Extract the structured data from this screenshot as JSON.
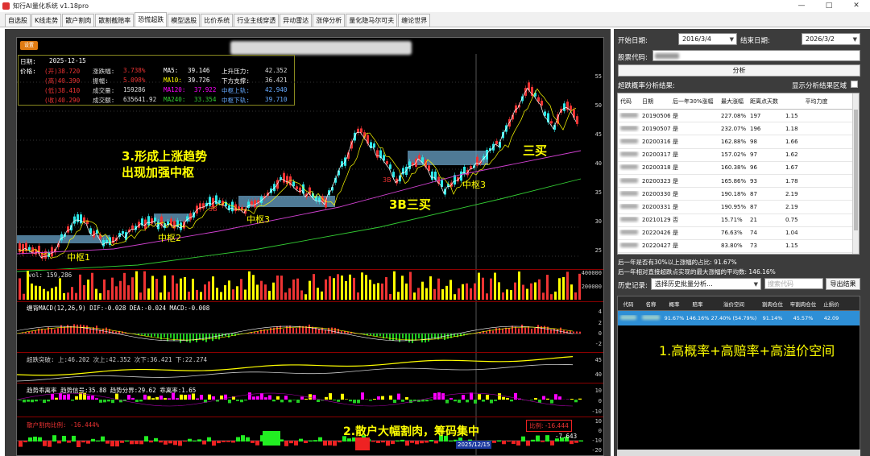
{
  "window": {
    "title": "知行AI量化系统 v1.18pro",
    "min": "—",
    "max": "□",
    "close": "✕"
  },
  "tabs": [
    "自选股",
    "K线走势",
    "散户割肉",
    "散割截赔率",
    "恐慌超跌",
    "模型选股",
    "比价系统",
    "行业主线穿透",
    "异动雷达",
    "涨停分析",
    "量化隐马尔可夫",
    "缠论世界"
  ],
  "active_tab": 4,
  "chart": {
    "set_button": "设置",
    "info": {
      "date_label": "日期:",
      "date": "2025-12-15",
      "price_label": "价格:",
      "open": "(开)38.720",
      "high": "(高)40.390",
      "low": "(低)38.410",
      "close": "(收)40.290",
      "chg_label": "涨跌幅:",
      "chg": "3.738%",
      "amp_label": "振幅:",
      "amp": "5.098%",
      "vol_label": "成交量:",
      "vol": "159286",
      "amt_label": "成交额:",
      "amt": "635641.92",
      "ma5_label": "MA5:",
      "ma5": "39.146",
      "ma10_label": "MA10:",
      "ma10": "39.726",
      "ma120_label": "MA120:",
      "ma120": "37.922",
      "ma240_label": "MA240:",
      "ma240": "33.354",
      "up_label": "上升压力:",
      "up": "42.352",
      "down_label": "下方支撑:",
      "down": "36.421",
      "mid_up_label": "中枢上轨:",
      "mid_up": "42.940",
      "mid_dn_label": "中枢下轨:",
      "mid_dn": "39.710"
    },
    "annotations": {
      "trend": "3.形成上涨趋势",
      "trend2": "出现加强中枢",
      "z1": "中枢1",
      "z2": "中枢2",
      "z3": "中枢3",
      "z3b": "中枢3",
      "sanmai": "三买",
      "b3": "3B三买",
      "b_small": "3B",
      "b_small2": "3B",
      "retail": "2.散户大幅割肉，筹码集中"
    },
    "price_axis": [
      "55",
      "50",
      "45",
      "40",
      "35",
      "30",
      "25"
    ],
    "vol_panel": {
      "label": "vol: 159,286",
      "ticks": [
        "400000",
        "200000"
      ]
    },
    "macd_panel": {
      "label": "缠背MACD(12,26,9) DIF:-0.028 DEA:-0.024 MACD:-0.008",
      "ticks": [
        "4",
        "2",
        "0",
        "-2"
      ]
    },
    "break_panel": {
      "label": "超跌突破: 上:46.202 次上:42.352 次下:36.421 下:22.274",
      "ticks": [
        "45",
        "40"
      ]
    },
    "trend_panel": {
      "label": "趋势乖离率 趋势信号:35.88 趋势分界:29.62 乖离率:1.65",
      "ticks": [
        "10",
        "0",
        "-10"
      ]
    },
    "retail_panel": {
      "label": "散户割肉比例: -16.444%",
      "ratio": "比例: -16.444",
      "value": "-7.643",
      "ticks": [
        "10",
        "0",
        "-10",
        "-20"
      ]
    },
    "date_tag": "2025/12/15"
  },
  "right": {
    "start_label": "开始日期:",
    "start": "2016/3/4",
    "end_label": "结束日期:",
    "end": "2026/3/2",
    "code_label": "股票代码:",
    "analyze": "分析",
    "result_title": "超跌概率分析结果:",
    "show_area": "显示分析结果区域",
    "t1_head": [
      "代码",
      "日期",
      "后一年30%涨幅",
      "最大涨幅",
      "距离点天数",
      "平均力度"
    ],
    "t1_rows": [
      [
        "20190506",
        "是",
        "227.08%",
        "197",
        "1.15"
      ],
      [
        "20190507",
        "是",
        "232.07%",
        "196",
        "1.18"
      ],
      [
        "20200316",
        "是",
        "162.88%",
        "98",
        "1.66"
      ],
      [
        "20200317",
        "是",
        "157.02%",
        "97",
        "1.62"
      ],
      [
        "20200318",
        "是",
        "160.38%",
        "96",
        "1.67"
      ],
      [
        "20200323",
        "是",
        "165.86%",
        "93",
        "1.78"
      ],
      [
        "20200330",
        "是",
        "190.18%",
        "87",
        "2.19"
      ],
      [
        "20200331",
        "是",
        "190.95%",
        "87",
        "2.19"
      ],
      [
        "20210129",
        "否",
        "15.71%",
        "21",
        "0.75"
      ],
      [
        "20220426",
        "是",
        "76.63%",
        "74",
        "1.04"
      ],
      [
        "20220427",
        "是",
        "83.80%",
        "73",
        "1.15"
      ]
    ],
    "note1": "后一年是否有30%以上涨幅的占比: 91.67%",
    "note2": "后一年相对直接超跌点实现的最大涨幅的平均数: 146.16%",
    "history_label": "历史记录:",
    "history_select": "选择历史批量分析...",
    "search_ph": "搜索代码",
    "export": "导出结果",
    "t2_head": [
      "代码",
      "名称",
      "概率",
      "赔率",
      "溢价空间",
      "割肉仓位",
      "牢割肉仓位",
      "止损价"
    ],
    "t2_row": [
      "91.67%",
      "146.16%",
      "27.40% (54.79%)",
      "91.14%",
      "45.57%",
      "42.09"
    ],
    "big_note": "1.高概率+高赔率+高溢价空间"
  }
}
